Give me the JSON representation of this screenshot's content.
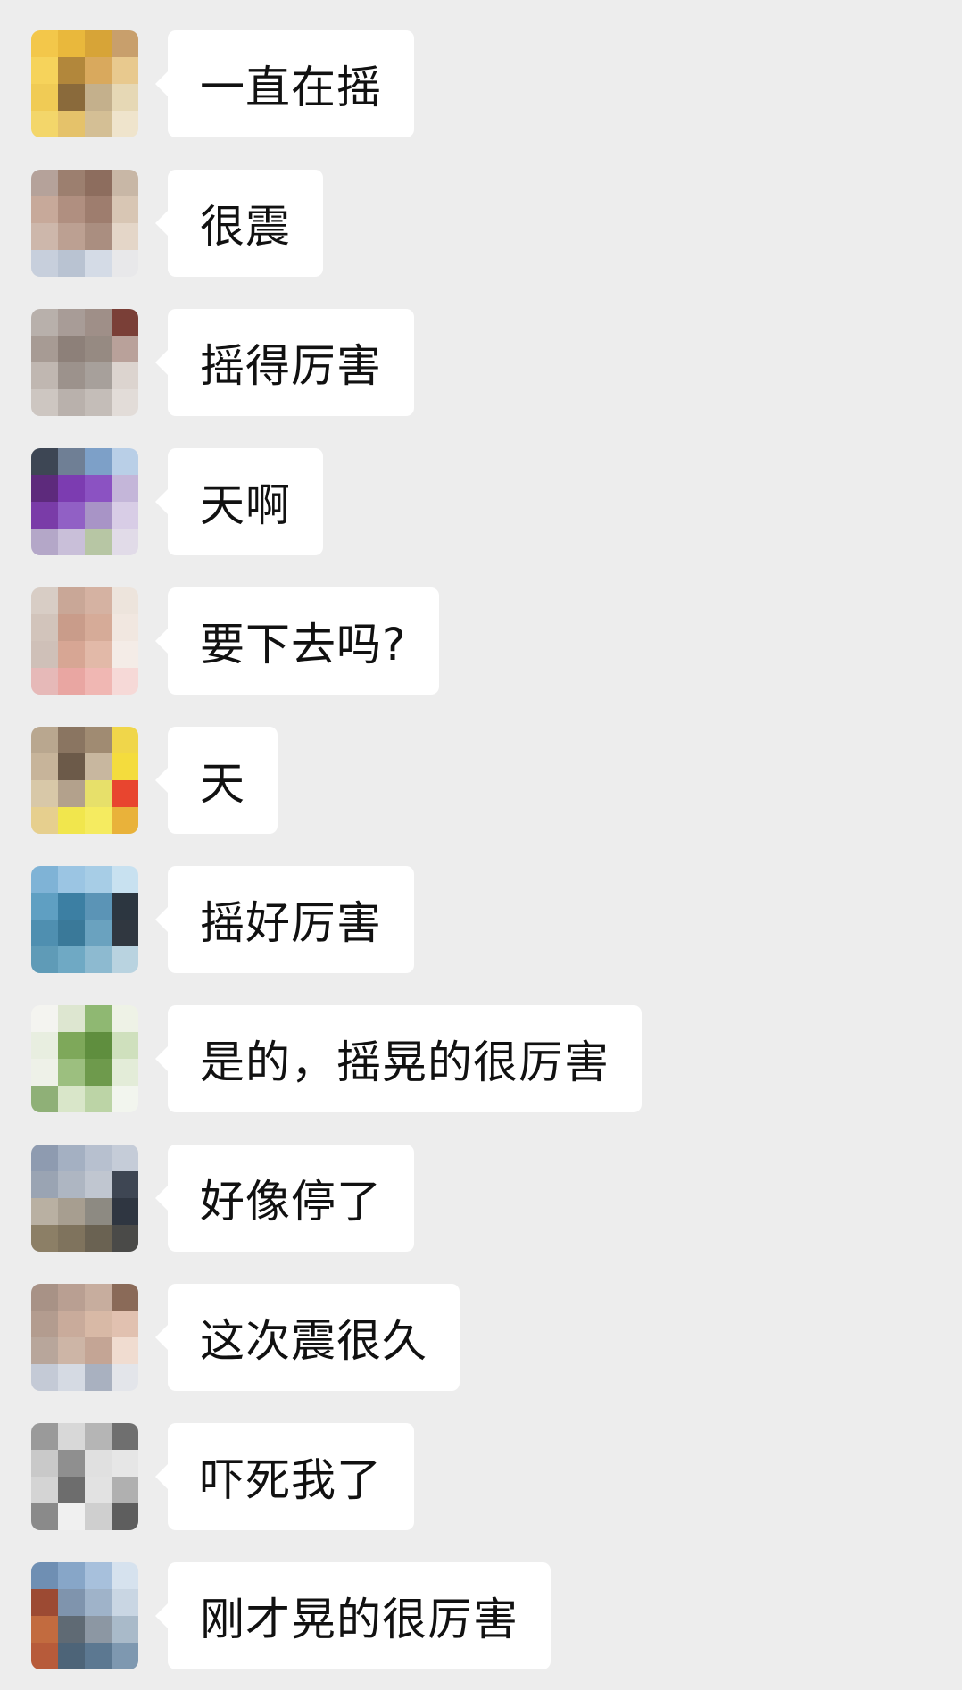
{
  "colors": {
    "background": "#ededed",
    "bubble": "#ffffff",
    "text": "#111111"
  },
  "messages": [
    {
      "text": "一直在摇",
      "avatar_icon": "pixelated-avatar-icon",
      "avatar_palette": [
        "#f3c74a",
        "#e9b83c",
        "#d7a437",
        "#c89f6c",
        "#f6d35b",
        "#b2873b",
        "#d9a95d",
        "#e8c98e",
        "#f0cb55",
        "#8a6a3b",
        "#c4b08c",
        "#e6d8b5",
        "#f3d66a",
        "#e5c26a",
        "#d4bf95",
        "#efe4cc"
      ]
    },
    {
      "text": "很震",
      "avatar_icon": "pixelated-avatar-icon",
      "avatar_palette": [
        "#b5a29a",
        "#9c7f6f",
        "#8d6d5e",
        "#c8b7a6",
        "#c7a99a",
        "#b08f80",
        "#9e7d6e",
        "#d8c6b4",
        "#cdb7ab",
        "#bca092",
        "#aa8e80",
        "#e4d6c8",
        "#c7cfdc",
        "#b9c3d2",
        "#d4dbe6",
        "#e8e8ea"
      ]
    },
    {
      "text": "摇得厉害",
      "avatar_icon": "pixelated-avatar-icon",
      "avatar_palette": [
        "#b8b0ab",
        "#a89c97",
        "#9f8f88",
        "#7a3f37",
        "#a79b94",
        "#8d8079",
        "#968a82",
        "#b9a19a",
        "#c0b7b1",
        "#9c928c",
        "#a7a09b",
        "#dcd4cf",
        "#cdc6c1",
        "#b9b1ac",
        "#c4bdb8",
        "#e2dcd8"
      ]
    },
    {
      "text": "天啊",
      "avatar_icon": "pixelated-avatar-icon",
      "avatar_palette": [
        "#3d4654",
        "#6f7f95",
        "#7da0c8",
        "#b9cfe7",
        "#5d2a7c",
        "#7c3cb1",
        "#8b52c2",
        "#c4b6d9",
        "#7a3ca8",
        "#9160c5",
        "#a894c6",
        "#d8cde6",
        "#b4a7c8",
        "#c9bfd9",
        "#b7c6a4",
        "#e1dbe8"
      ]
    },
    {
      "text": "要下去吗?",
      "avatar_icon": "pixelated-avatar-icon",
      "avatar_palette": [
        "#d8cdc5",
        "#c9a797",
        "#d5b2a2",
        "#ede4dc",
        "#d2c4bb",
        "#c99c8a",
        "#d6ab98",
        "#f1e7e0",
        "#cfc0b8",
        "#d7a694",
        "#e2b9a8",
        "#f4ece7",
        "#e6b9b8",
        "#e9a6a2",
        "#f0b7b3",
        "#f6d9d7"
      ]
    },
    {
      "text": "天",
      "avatar_icon": "pixelated-avatar-icon",
      "avatar_palette": [
        "#b9a78f",
        "#8a7561",
        "#a08b72",
        "#f0d64a",
        "#c7b49a",
        "#6c5a49",
        "#c8b79f",
        "#f4dc3d",
        "#d8c8a8",
        "#b3a18c",
        "#e7e06a",
        "#e8452f",
        "#e6cf8e",
        "#f1e64d",
        "#f5eb60",
        "#e9b23a"
      ]
    },
    {
      "text": "摇好厉害",
      "avatar_icon": "pixelated-avatar-icon",
      "avatar_palette": [
        "#7fb3d6",
        "#9bc5e3",
        "#a7cde6",
        "#c8e1f0",
        "#5f9fc2",
        "#3c7fa3",
        "#5b94b6",
        "#2c3640",
        "#4f8fb0",
        "#3a7999",
        "#6aa2bf",
        "#303740",
        "#5f9bb7",
        "#6fa9c4",
        "#8dbad0",
        "#b9d3e0"
      ]
    },
    {
      "text": "是的，摇晃的很厉害",
      "avatar_icon": "pixelated-avatar-icon",
      "avatar_palette": [
        "#f4f4f0",
        "#dde6d0",
        "#8fb872",
        "#eef2e6",
        "#e8eee0",
        "#7ea85a",
        "#5f8e3e",
        "#cfe0bd",
        "#eef1e8",
        "#9cbf7f",
        "#6e9a4c",
        "#e3ecd8",
        "#8fb077",
        "#d9e6c9",
        "#bcd4a6",
        "#f2f5ee"
      ]
    },
    {
      "text": "好像停了",
      "avatar_icon": "pixelated-avatar-icon",
      "avatar_palette": [
        "#8e9bb0",
        "#a4b0c2",
        "#b7c0cf",
        "#c5ccd8",
        "#9aa4b3",
        "#aeb6c2",
        "#c0c6d0",
        "#3e4653",
        "#b9b0a2",
        "#a79e90",
        "#8d8a82",
        "#2f3641",
        "#8c7f66",
        "#7f735d",
        "#6a6252",
        "#4a4a48"
      ]
    },
    {
      "text": "这次震很久",
      "avatar_icon": "pixelated-avatar-icon",
      "avatar_palette": [
        "#a89286",
        "#b99f92",
        "#c7ad9e",
        "#8a6a58",
        "#b39c8f",
        "#c9ab9b",
        "#d8b9a6",
        "#e1c1b0",
        "#b8a69b",
        "#cdb5a6",
        "#c4a595",
        "#f0dcd0",
        "#c4cad6",
        "#d5dae3",
        "#a9b1c0",
        "#e3e5ea"
      ]
    },
    {
      "text": "吓死我了",
      "avatar_icon": "pixelated-avatar-icon",
      "avatar_palette": [
        "#9a9a9a",
        "#d8d8d8",
        "#b5b5b5",
        "#6f6f6f",
        "#c9c9c9",
        "#8f8f8f",
        "#e0e0e0",
        "#e6e6e6",
        "#d4d4d4",
        "#6d6d6d",
        "#e2e2e2",
        "#b0b0b0",
        "#8a8a8a",
        "#f0f0f0",
        "#cfcfcf",
        "#5e5e5e"
      ]
    },
    {
      "text": "刚才晃的很厉害",
      "avatar_icon": "pixelated-avatar-icon",
      "avatar_palette": [
        "#6f8fb3",
        "#87a6c8",
        "#a7c0dc",
        "#d6e2ee",
        "#9c4a33",
        "#7f94ad",
        "#9fb3c9",
        "#c9d6e3",
        "#c26b3f",
        "#5f6a74",
        "#8c97a3",
        "#a9bac9",
        "#b75b3a",
        "#4d6478",
        "#5c7891",
        "#7e98b0"
      ]
    }
  ]
}
